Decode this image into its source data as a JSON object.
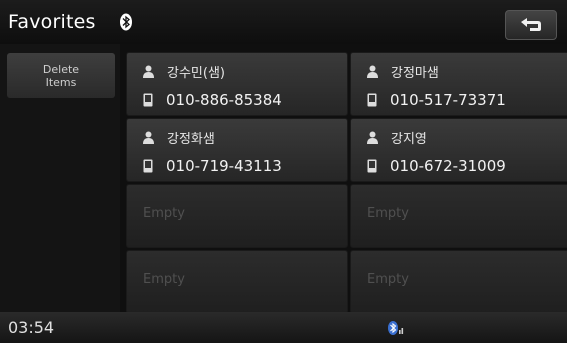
{
  "header": {
    "title": "Favorites",
    "bluetooth_icon": "bluetooth-icon",
    "back_icon": "back-arrow-icon"
  },
  "left_panel": {
    "delete_line1": "Delete",
    "delete_line2": "Items"
  },
  "favorites": [
    {
      "name": "강수민(샘)",
      "phone": "010-886-85384"
    },
    {
      "name": "강정마샘",
      "phone": "010-517-73371"
    },
    {
      "name": "강정화샘",
      "phone": "010-719-43113"
    },
    {
      "name": "강지영",
      "phone": "010-672-31009"
    },
    {
      "empty_label": "Empty"
    },
    {
      "empty_label": "Empty"
    },
    {
      "empty_label": "Empty"
    },
    {
      "empty_label": "Empty"
    }
  ],
  "status_bar": {
    "time": "03:54",
    "indicator_icon": "bluetooth-signal-icon"
  }
}
